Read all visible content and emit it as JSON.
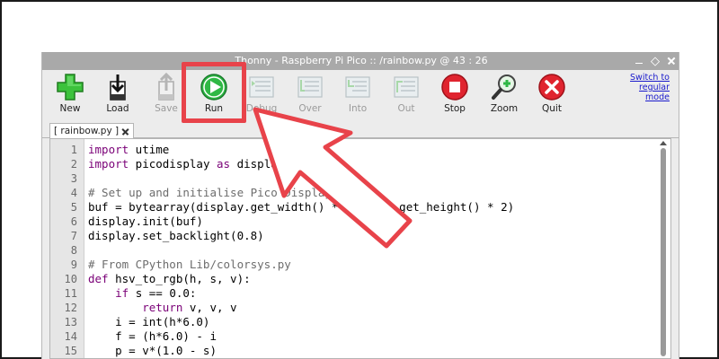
{
  "window": {
    "title": "Thonny  -  Raspberry Pi Pico :: /rainbow.py  @  43 : 26"
  },
  "toolbar": {
    "items": [
      {
        "label": "New",
        "icon": "new-icon",
        "enabled": true
      },
      {
        "label": "Load",
        "icon": "load-icon",
        "enabled": true
      },
      {
        "label": "Save",
        "icon": "save-icon",
        "enabled": false
      },
      {
        "label": "Run",
        "icon": "run-icon",
        "enabled": true
      },
      {
        "label": "Debug",
        "icon": "debug-icon",
        "enabled": false
      },
      {
        "label": "Over",
        "icon": "step-over-icon",
        "enabled": false
      },
      {
        "label": "Into",
        "icon": "step-into-icon",
        "enabled": false
      },
      {
        "label": "Out",
        "icon": "step-out-icon",
        "enabled": false
      },
      {
        "label": "Stop",
        "icon": "stop-icon",
        "enabled": true
      },
      {
        "label": "Zoom",
        "icon": "zoom-icon",
        "enabled": true
      },
      {
        "label": "Quit",
        "icon": "quit-icon",
        "enabled": true
      }
    ],
    "switch_mode": "Switch to regular mode"
  },
  "tabs": [
    {
      "label": "[ rainbow.py ]"
    }
  ],
  "editor": {
    "line_numbers": [
      "1",
      "2",
      "3",
      "4",
      "5",
      "6",
      "7",
      "8",
      "9",
      "10",
      "11",
      "12",
      "13",
      "14",
      "15"
    ],
    "lines": [
      "import utime",
      "import picodisplay as display",
      "",
      "# Set up and initialise Pico Display",
      "buf = bytearray(display.get_width() * display.get_height() * 2)",
      "display.init(buf)",
      "display.set_backlight(0.8)",
      "",
      "# From CPython Lib/colorsys.py",
      "def hsv_to_rgb(h, s, v):",
      "    if s == 0.0:",
      "        return v, v, v",
      "    i = int(h*6.0)",
      "    f = (h*6.0) - i",
      "    p = v*(1.0 - s)"
    ]
  },
  "colors": {
    "highlight": "#e8434a",
    "keyword": "#7a0077",
    "comment": "#6d6d6d"
  }
}
